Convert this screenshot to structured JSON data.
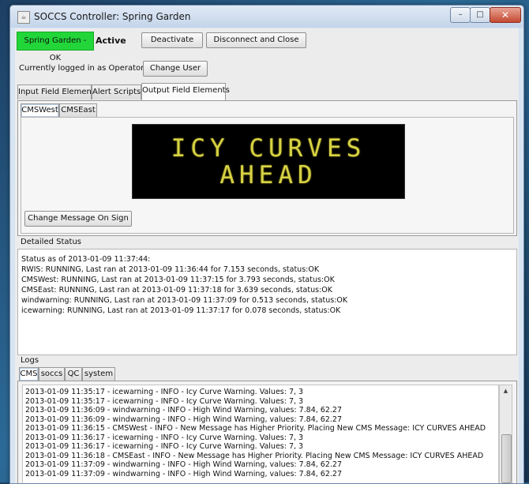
{
  "window": {
    "title": "SOCCS Controller: Spring Garden",
    "minimize": "–",
    "maximize": "□",
    "close": "✕"
  },
  "status": {
    "badge": "Spring Garden - OK",
    "state": "Active",
    "badge_color": "#22d63a"
  },
  "buttons": {
    "deactivate": "Deactivate",
    "disconnect": "Disconnect and Close",
    "change_user": "Change User",
    "change_message": "Change Message On Sign"
  },
  "login": {
    "text": "Currently logged in as Operator"
  },
  "main_tabs": [
    "Input Field Elements",
    "Alert Scripts",
    "Output Field Elements"
  ],
  "sign_tabs": [
    "CMSWest",
    "CMSEast"
  ],
  "sign": {
    "line1": "ICY CURVES",
    "line2": "AHEAD",
    "text_color": "#d7d243"
  },
  "detailed_status": {
    "label": "Detailed Status",
    "lines": [
      "Status as of 2013-01-09 11:37:44:",
      "RWIS: RUNNING, Last ran at 2013-01-09 11:36:44 for 7.153 seconds, status:OK",
      "CMSWest: RUNNING, Last ran at 2013-01-09 11:37:15 for 3.793 seconds, status:OK",
      "CMSEast: RUNNING, Last ran at 2013-01-09 11:37:18 for 3.639 seconds, status:OK",
      "windwarning: RUNNING, Last ran at 2013-01-09 11:37:09 for 0.513 seconds, status:OK",
      "icewarning: RUNNING, Last ran at 2013-01-09 11:37:17 for 0.078 seconds, status:OK"
    ]
  },
  "logs": {
    "label": "Logs",
    "tabs": [
      "CMS",
      "soccs",
      "QC",
      "system"
    ],
    "lines": [
      "2013-01-09 11:35:17 - icewarning - INFO - Icy Curve Warning. Values: 7, 3",
      "2013-01-09 11:35:17 - icewarning - INFO - Icy Curve Warning. Values: 7, 3",
      "2013-01-09 11:36:09 - windwarning - INFO - High Wind Warning, values: 7.84, 62.27",
      "2013-01-09 11:36:09 - windwarning - INFO - High Wind Warning, values: 7.84, 62.27",
      "2013-01-09 11:36:15 - CMSWest - INFO - New Message has Higher Priority. Placing New CMS Message: ICY CURVES AHEAD",
      "2013-01-09 11:36:17 - icewarning - INFO - Icy Curve Warning. Values: 7, 3",
      "2013-01-09 11:36:17 - icewarning - INFO - Icy Curve Warning. Values: 7, 3",
      "2013-01-09 11:36:18 - CMSEast - INFO - New Message has Higher Priority. Placing New CMS Message: ICY CURVES AHEAD",
      "2013-01-09 11:37:09 - windwarning - INFO - High Wind Warning, values: 7.84, 62.27",
      "2013-01-09 11:37:09 - windwarning - INFO - High Wind Warning, values: 7.84, 62.27"
    ]
  }
}
